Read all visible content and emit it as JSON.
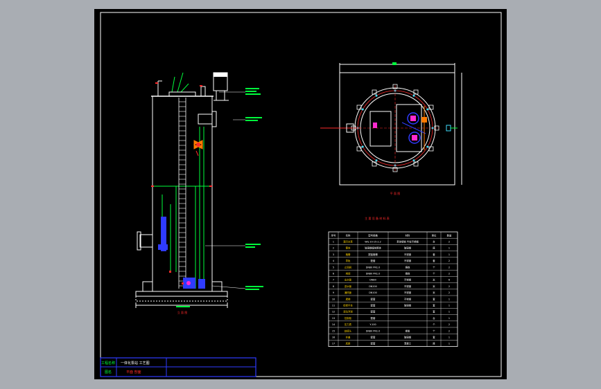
{
  "canvas": {
    "background": "#a9adb3",
    "sheet_background": "#000000",
    "line_color": "#ffffff",
    "accent_green": "#00ff3c",
    "accent_blue": "#2f3bff",
    "accent_red": "#ff2a2a",
    "accent_magenta": "#ff2ad0",
    "accent_cyan": "#3fe0ff",
    "accent_yellow": "#ffd400"
  },
  "drawing": {
    "title_block": {
      "row1_label": "工程名称",
      "row1_value": "一体化泵站 工艺图",
      "row2_label": "图名",
      "row2_value": "平面 剖面"
    },
    "elevation": {
      "caption": "立 面 图"
    },
    "plan": {
      "caption": "平 面 图"
    },
    "table": {
      "title": "主 要 设 备 材 料 表",
      "headers": [
        "序号",
        "名称",
        "型号规格",
        "材料",
        "单位",
        "数量"
      ],
      "rows": [
        [
          "1",
          "潜污水泵",
          "WQ 20-15-2.2",
          "泵体铸铁 叶轮不锈钢",
          "台",
          "2"
        ],
        [
          "2",
          "筒体",
          "玻璃钢缠绕筒体",
          "玻璃钢",
          "座",
          "1"
        ],
        [
          "3",
          "格栅",
          "提篮格栅",
          "不锈钢",
          "套",
          "1"
        ],
        [
          "4",
          "导轨",
          "配套",
          "不锈钢",
          "套",
          "2"
        ],
        [
          "5",
          "止回阀",
          "DN80 PN1.0",
          "铸铁",
          "个",
          "2"
        ],
        [
          "6",
          "闸阀",
          "DN80 PN1.0",
          "铸铁",
          "个",
          "2"
        ],
        [
          "7",
          "出水管",
          "DN80",
          "不锈钢",
          "米",
          "6"
        ],
        [
          "8",
          "进水管",
          "DN200",
          "不锈钢",
          "米",
          "2"
        ],
        [
          "9",
          "通风管",
          "DN100",
          "不锈钢",
          "米",
          "2"
        ],
        [
          "10",
          "爬梯",
          "配套",
          "不锈钢",
          "套",
          "1"
        ],
        [
          "11",
          "检修平台",
          "配套",
          "玻璃钢",
          "套",
          "1"
        ],
        [
          "12",
          "液位浮球",
          "配套",
          "",
          "套",
          "1"
        ],
        [
          "13",
          "控制柜",
          "配套",
          "",
          "台",
          "1"
        ],
        [
          "14",
          "压力表",
          "Y-100",
          "",
          "个",
          "2"
        ],
        [
          "15",
          "软接头",
          "DN80 PN1.0",
          "橡胶",
          "个",
          "2"
        ],
        [
          "16",
          "井盖",
          "配套",
          "玻璃钢",
          "套",
          "1"
        ],
        [
          "17",
          "底座",
          "配套",
          "混凝土",
          "座",
          "1"
        ]
      ]
    }
  }
}
